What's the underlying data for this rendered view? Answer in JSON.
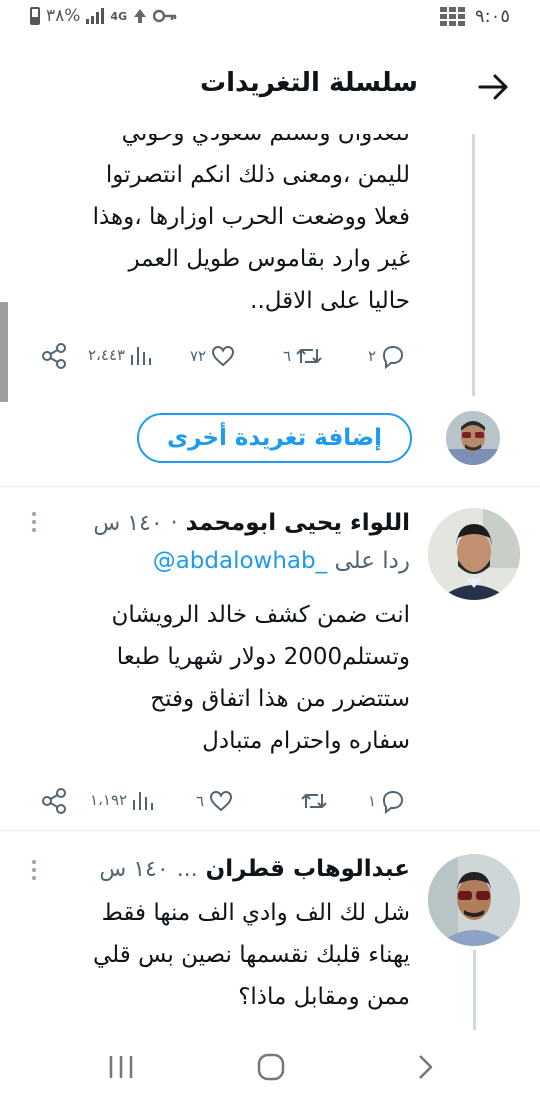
{
  "status_bar": {
    "battery_percent": "٣٨%",
    "network": "4G",
    "time": "٩:٠٥"
  },
  "header": {
    "title": "سلسلة التغريدات",
    "back_icon": "arrow-right-icon"
  },
  "tweet1": {
    "text_lines": [
      "للعدوان وتسلم سعودي وحوثي",
      "لليمن ،ومعنى ذلك انكم انتصرتوا",
      "فعلا ووضعت الحرب اوزارها ،وهذا",
      "غير وارد بقاموس طويل العمر",
      "حاليا على الاقل.."
    ],
    "replies": "٢",
    "retweets": "٦",
    "likes": "٧٢",
    "views": "٢،٤٤٣"
  },
  "add_tweet": {
    "label": "إضافة تغريدة أخرى"
  },
  "tweet2": {
    "author": "اللواء يحيى ابومحمد",
    "separator": "·",
    "time": "١٤٠ س",
    "reply_prefix": "ردا على",
    "reply_handle": "@abdalowhab_",
    "text_lines": [
      "انت ضمن كشف خالد الرويشان",
      "وتستلم2000 دولار شهريا طبعا",
      "ستتضرر من هذا اتفاق وفتح",
      "سفاره واحترام متبادل"
    ],
    "replies": "١",
    "retweets": "",
    "likes": "٦",
    "views": "١،١٩٢"
  },
  "tweet3": {
    "author": "عبدالوهاب قطران",
    "ellipsis": "...",
    "time": "١٤٠ س",
    "text_lines": [
      "شل لك الف وادي الف منها فقط",
      "يهناء قلبك نقسمها نصين بس قلي",
      "ممن ومقابل ماذا؟"
    ]
  },
  "colors": {
    "accent": "#1d9bf0",
    "text": "#0f1419",
    "muted": "#536471"
  }
}
